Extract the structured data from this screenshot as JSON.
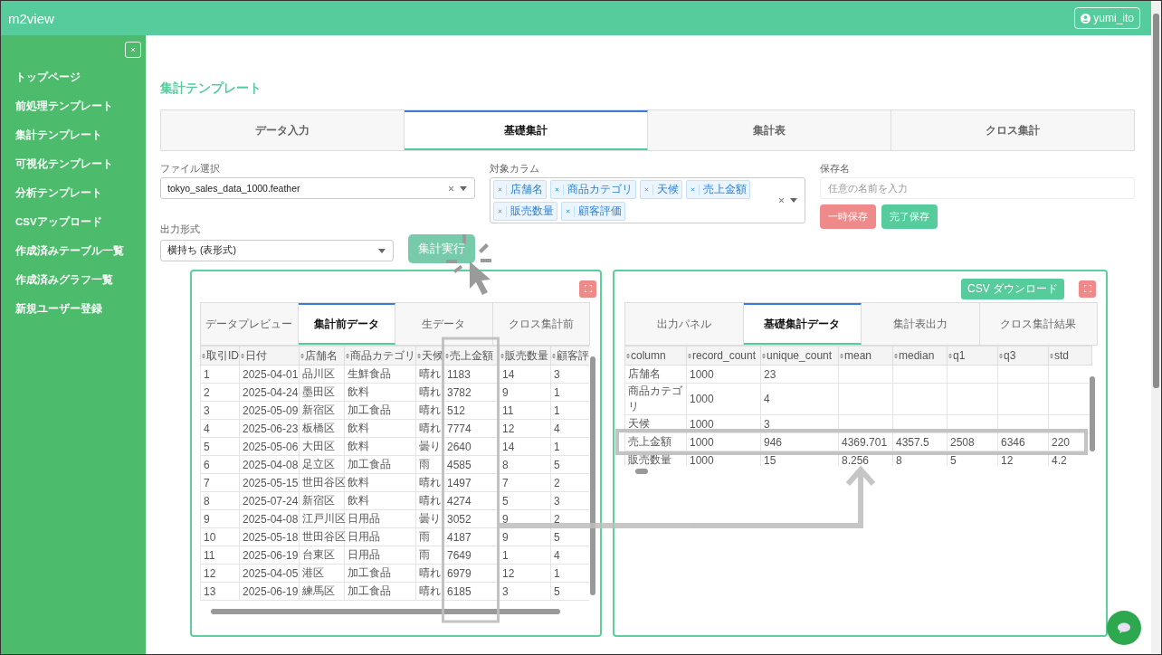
{
  "app": {
    "title": "m2view",
    "user": "yumi_ito"
  },
  "sidebar": {
    "items": [
      {
        "label": "トップページ"
      },
      {
        "label": "前処理テンプレート"
      },
      {
        "label": "集計テンプレート"
      },
      {
        "label": "可視化テンプレート"
      },
      {
        "label": "分析テンプレート"
      },
      {
        "label": "CSVアップロード"
      },
      {
        "label": "作成済みテーブル一覧"
      },
      {
        "label": "作成済みグラフ一覧"
      },
      {
        "label": "新規ユーザー登録"
      }
    ]
  },
  "page_title": "集計テンプレート",
  "tabs": [
    {
      "label": "データ入力",
      "selected": false
    },
    {
      "label": "基礎集計",
      "selected": true
    },
    {
      "label": "集計表",
      "selected": false
    },
    {
      "label": "クロス集計",
      "selected": false
    }
  ],
  "form": {
    "file": {
      "label": "ファイル選択",
      "value": "tokyo_sales_data_1000.feather"
    },
    "columns": {
      "label": "対象カラム",
      "tags": [
        "店舗名",
        "商品カテゴリ",
        "天候",
        "売上金額",
        "販売数量",
        "顧客評価"
      ]
    },
    "save_name": {
      "label": "保存名",
      "placeholder": "任意の名前を入力"
    },
    "buttons": [
      {
        "label": "一時保存",
        "kind": "danger"
      },
      {
        "label": "完了保存",
        "kind": "success"
      }
    ],
    "output_format": {
      "label": "出力形式",
      "value": "横持ち (表形式)"
    },
    "run_button": {
      "label": "集計実行",
      "disabled": true
    }
  },
  "left_panel": {
    "tabs": [
      {
        "label": "データプレビュー",
        "selected": false
      },
      {
        "label": "集計前データ",
        "selected": true
      },
      {
        "label": "生データ",
        "selected": false
      },
      {
        "label": "クロス集計前",
        "selected": false
      }
    ],
    "columns": [
      "取引ID",
      "日付",
      "店舗名",
      "商品カテゴリ",
      "天候",
      "売上金額",
      "販売数量",
      "顧客評"
    ],
    "rows": [
      [
        "1",
        "2025-04-01",
        "品川区",
        "生鮮食品",
        "晴れ",
        "1183",
        "14",
        "3"
      ],
      [
        "2",
        "2025-04-24",
        "墨田区",
        "飲料",
        "晴れ",
        "3782",
        "9",
        "1"
      ],
      [
        "3",
        "2025-05-09",
        "新宿区",
        "加工食品",
        "晴れ",
        "512",
        "11",
        "1"
      ],
      [
        "4",
        "2025-06-23",
        "板橋区",
        "飲料",
        "晴れ",
        "7774",
        "12",
        "4"
      ],
      [
        "5",
        "2025-05-06",
        "大田区",
        "飲料",
        "曇り",
        "2640",
        "14",
        "1"
      ],
      [
        "6",
        "2025-04-08",
        "足立区",
        "加工食品",
        "雨",
        "4585",
        "8",
        "5"
      ],
      [
        "7",
        "2025-05-15",
        "世田谷区",
        "飲料",
        "晴れ",
        "1497",
        "7",
        "2"
      ],
      [
        "8",
        "2025-07-24",
        "新宿区",
        "飲料",
        "晴れ",
        "4274",
        "5",
        "3"
      ],
      [
        "9",
        "2025-04-08",
        "江戸川区",
        "日用品",
        "曇り",
        "3052",
        "9",
        "2"
      ],
      [
        "10",
        "2025-05-18",
        "世田谷区",
        "日用品",
        "雨",
        "4187",
        "9",
        "5"
      ],
      [
        "11",
        "2025-06-19",
        "台東区",
        "日用品",
        "雨",
        "7649",
        "1",
        "4"
      ],
      [
        "12",
        "2025-04-05",
        "港区",
        "加工食品",
        "晴れ",
        "6979",
        "12",
        "1"
      ],
      [
        "13",
        "2025-06-19",
        "練馬区",
        "加工食品",
        "晴れ",
        "6185",
        "3",
        "5"
      ]
    ]
  },
  "right_panel": {
    "download_button": "CSV ダウンロード",
    "tabs": [
      {
        "label": "出力パネル",
        "selected": false
      },
      {
        "label": "基礎集計データ",
        "selected": true
      },
      {
        "label": "集計表出力",
        "selected": false
      },
      {
        "label": "クロス集計結果",
        "selected": false
      }
    ],
    "columns": [
      "column",
      "record_count",
      "unique_count",
      "mean",
      "median",
      "q1",
      "q3",
      "std"
    ],
    "rows": [
      [
        "店舗名",
        "1000",
        "23",
        "",
        "",
        "",
        "",
        ""
      ],
      [
        "商品カテゴリ",
        "1000",
        "4",
        "",
        "",
        "",
        "",
        ""
      ],
      [
        "天候",
        "1000",
        "3",
        "",
        "",
        "",
        "",
        ""
      ],
      [
        "売上金額",
        "1000",
        "946",
        "4369.701",
        "4357.5",
        "2508",
        "6346",
        "220"
      ],
      [
        "販売数量",
        "1000",
        "15",
        "8.256",
        "8",
        "5",
        "12",
        "4.2"
      ]
    ]
  }
}
